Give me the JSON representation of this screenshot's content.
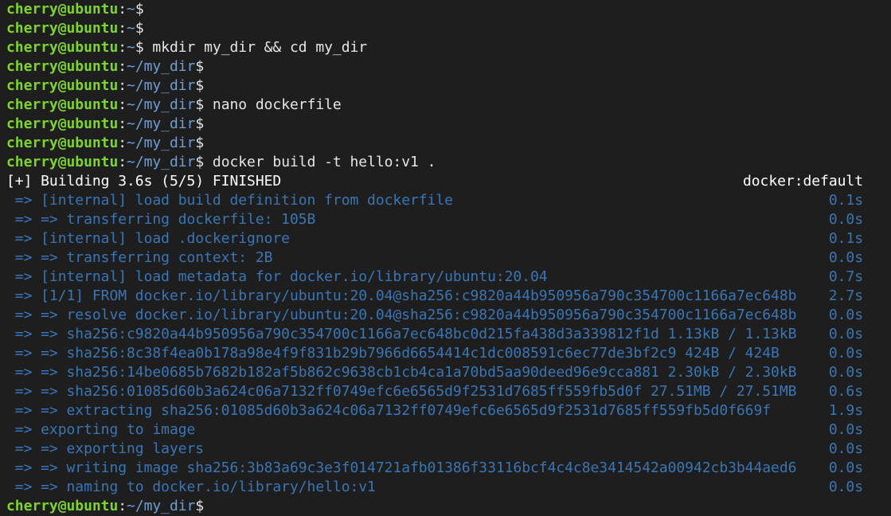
{
  "colors": {
    "background": "#1e1e1e",
    "prompt_user": "#7fd32e",
    "prompt_path": "#6f9fd6",
    "command_text": "#e6e6e6",
    "build_step": "#3a75b5"
  },
  "prompt": {
    "user_host": "cherry@ubuntu",
    "colon": ":",
    "dollar": "$"
  },
  "lines": [
    {
      "type": "prompt",
      "path": "~",
      "cmd": ""
    },
    {
      "type": "prompt",
      "path": "~",
      "cmd": ""
    },
    {
      "type": "prompt",
      "path": "~",
      "cmd": " mkdir my_dir && cd my_dir"
    },
    {
      "type": "prompt",
      "path": "~/my_dir",
      "cmd": ""
    },
    {
      "type": "prompt",
      "path": "~/my_dir",
      "cmd": ""
    },
    {
      "type": "prompt",
      "path": "~/my_dir",
      "cmd": " nano dockerfile"
    },
    {
      "type": "prompt",
      "path": "~/my_dir",
      "cmd": ""
    },
    {
      "type": "prompt",
      "path": "~/my_dir",
      "cmd": ""
    },
    {
      "type": "prompt",
      "path": "~/my_dir",
      "cmd": " docker build -t hello:v1 ."
    },
    {
      "type": "header",
      "text": "[+] Building 3.6s (5/5) FINISHED",
      "context": "docker:default"
    },
    {
      "type": "step",
      "text": " => [internal] load build definition from dockerfile",
      "time": "0.1s"
    },
    {
      "type": "step",
      "text": " => => transferring dockerfile: 105B",
      "time": "0.0s"
    },
    {
      "type": "step",
      "text": " => [internal] load .dockerignore",
      "time": "0.1s"
    },
    {
      "type": "step",
      "text": " => => transferring context: 2B",
      "time": "0.0s"
    },
    {
      "type": "step",
      "text": " => [internal] load metadata for docker.io/library/ubuntu:20.04",
      "time": "0.7s"
    },
    {
      "type": "step",
      "text": " => [1/1] FROM docker.io/library/ubuntu:20.04@sha256:c9820a44b950956a790c354700c1166a7ec648b",
      "time": "2.7s"
    },
    {
      "type": "step",
      "text": " => => resolve docker.io/library/ubuntu:20.04@sha256:c9820a44b950956a790c354700c1166a7ec648b",
      "time": "0.0s"
    },
    {
      "type": "step",
      "text": " => => sha256:c9820a44b950956a790c354700c1166a7ec648bc0d215fa438d3a339812f1d 1.13kB / 1.13kB",
      "time": "0.0s"
    },
    {
      "type": "step",
      "text": " => => sha256:8c38f4ea0b178a98e4f9f831b29b7966d6654414c1dc008591c6ec77de3bf2c9 424B / 424B",
      "time": "0.0s"
    },
    {
      "type": "step",
      "text": " => => sha256:14be0685b7682b182af5b862c9638cb1cb4ca1a70bd5aa90deed96e9cca881 2.30kB / 2.30kB",
      "time": "0.0s"
    },
    {
      "type": "step",
      "text": " => => sha256:01085d60b3a624c06a7132ff0749efc6e6565d9f2531d7685ff559fb5d0f 27.51MB / 27.51MB",
      "time": "0.6s"
    },
    {
      "type": "step",
      "text": " => => extracting sha256:01085d60b3a624c06a7132ff0749efc6e6565d9f2531d7685ff559fb5d0f669f",
      "time": "1.9s"
    },
    {
      "type": "step",
      "text": " => exporting to image",
      "time": "0.0s"
    },
    {
      "type": "step",
      "text": " => => exporting layers",
      "time": "0.0s"
    },
    {
      "type": "step",
      "text": " => => writing image sha256:3b83a69c3e3f014721afb01386f33116bcf4c4c8e3414542a00942cb3b44aed6",
      "time": "0.0s"
    },
    {
      "type": "step",
      "text": " => => naming to docker.io/library/hello:v1",
      "time": "0.0s"
    },
    {
      "type": "prompt",
      "path": "~/my_dir",
      "cmd": ""
    }
  ]
}
